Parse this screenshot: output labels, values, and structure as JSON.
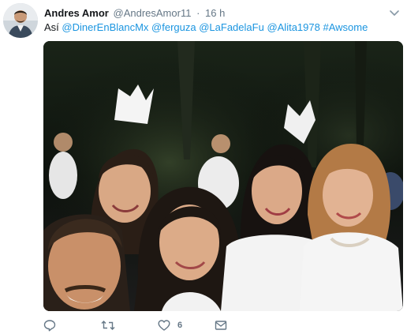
{
  "tweet": {
    "display_name": "Andres Amor",
    "handle": "@AndresAmor11",
    "separator": "·",
    "time": "16 h",
    "text_prefix": "Así ",
    "mentions": [
      "@DinerEnBlancMx",
      "@ferguza",
      "@LaFadelaFu",
      "@Alita1978",
      "#Awsome"
    ],
    "like_count": "6"
  },
  "icons": {
    "reply": "reply-icon",
    "retweet": "retweet-icon",
    "like": "heart-icon",
    "message": "envelope-icon",
    "more": "chevron-down-icon"
  },
  "colors": {
    "name": "#14171a",
    "meta": "#657786",
    "link": "#1b95e0"
  }
}
